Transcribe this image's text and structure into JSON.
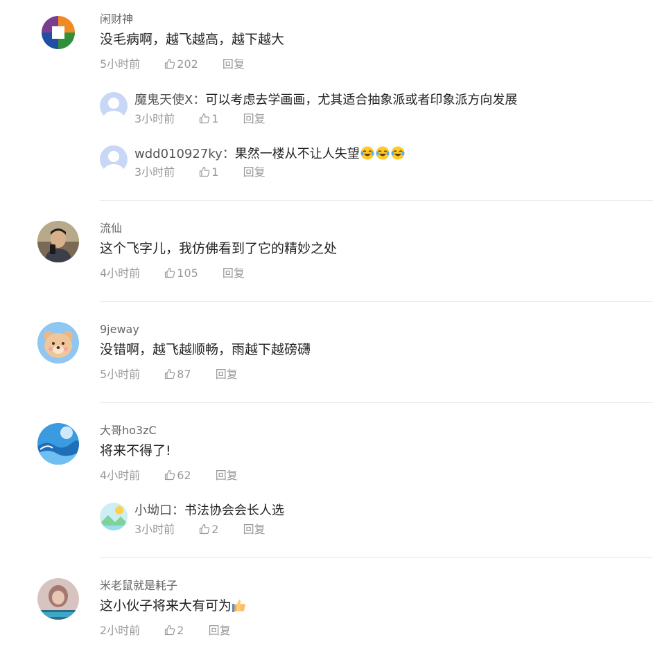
{
  "comments": [
    {
      "username": "闲财神",
      "text": "没毛病啊，越飞越高，越下越大",
      "time": "5小时前",
      "likes": "202",
      "reply_label": "回复",
      "replies": [
        {
          "username": "魔鬼天使X",
          "separator": "：",
          "text": "可以考虑去学画画，尤其适合抽象派或者印象派方向发展",
          "time": "3小时前",
          "likes": "1",
          "reply_label": "回复"
        },
        {
          "username": "wdd010927ky",
          "separator": "：",
          "text": "果然一楼从不让人失望",
          "emoji": "laughing-tears-emoji x3",
          "time": "3小时前",
          "likes": "1",
          "reply_label": "回复"
        }
      ]
    },
    {
      "username": "流仙",
      "text": "这个飞字儿，我仿佛看到了它的精妙之处",
      "time": "4小时前",
      "likes": "105",
      "reply_label": "回复"
    },
    {
      "username": "9jeway",
      "text": "没错啊，越飞越顺畅，雨越下越磅礴",
      "time": "5小时前",
      "likes": "87",
      "reply_label": "回复"
    },
    {
      "username": "大哥ho3zC",
      "text": "将来不得了!",
      "time": "4小时前",
      "likes": "62",
      "reply_label": "回复",
      "replies": [
        {
          "username": "小坳口",
          "separator": "：",
          "text": "书法协会会长人选",
          "time": "3小时前",
          "likes": "2",
          "reply_label": "回复"
        }
      ]
    },
    {
      "username": "米老鼠就是耗子",
      "text": "这小伙子将来大有可为",
      "emoji": "thumbs-up-emoji",
      "time": "2小时前",
      "likes": "2",
      "reply_label": "回复"
    }
  ],
  "colors": {
    "text": "#222222",
    "username": "#666666",
    "meta": "#999999",
    "divider": "#ececec"
  }
}
